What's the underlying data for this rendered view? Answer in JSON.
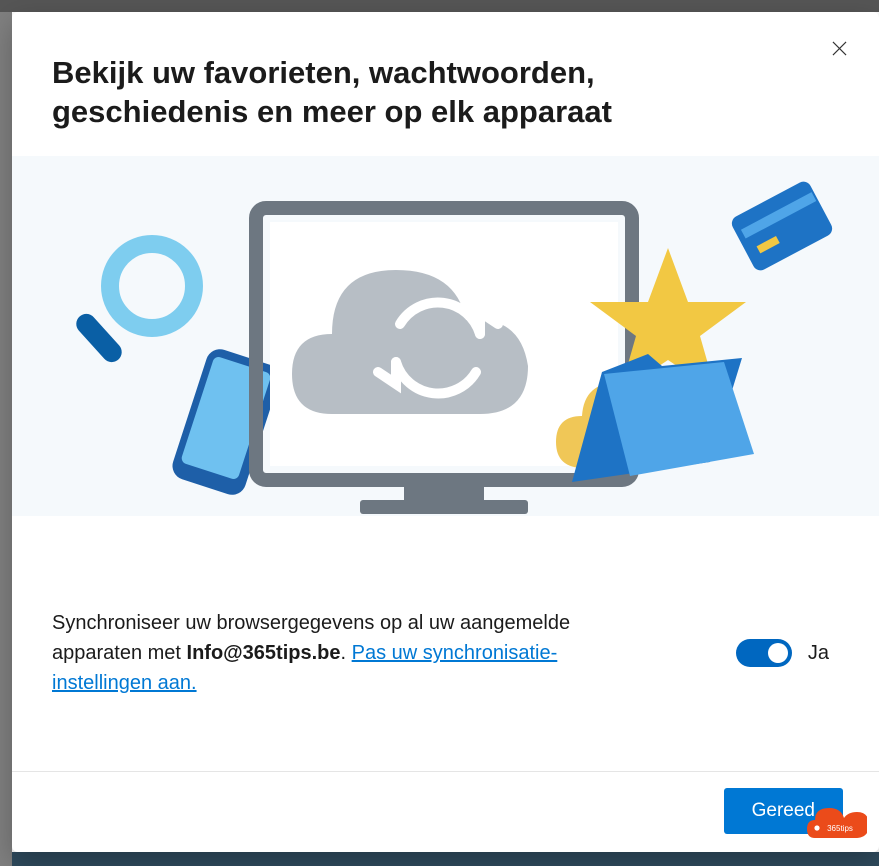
{
  "dialog": {
    "title": "Bekijk uw favorieten, wachtwoorden, geschiedenis en meer op elk apparaat",
    "sync_text_prefix": "Synchroniseer uw browsergegevens op al uw aangemelde apparaten met ",
    "sync_email": "Info@365tips.be",
    "sync_text_sep": ". ",
    "sync_link": "Pas uw synchronisatie-instellingen aan.",
    "toggle_label": "Ja",
    "toggle_on": true,
    "primary_button": "Gereed"
  },
  "logo": {
    "text": "365tips"
  },
  "colors": {
    "accent": "#0078d4",
    "link": "#0078d4"
  }
}
